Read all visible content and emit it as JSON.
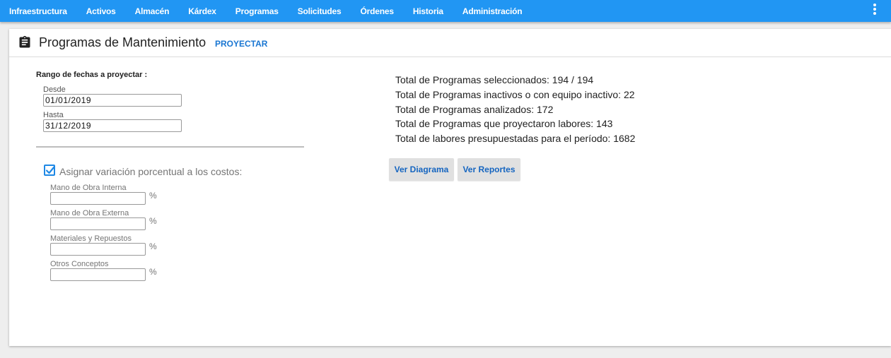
{
  "nav": {
    "items": [
      "Infraestructura",
      "Activos",
      "Almacén",
      "Kárdex",
      "Programas",
      "Solicitudes",
      "Órdenes",
      "Historia",
      "Administración"
    ]
  },
  "header": {
    "title": "Programas de Mantenimiento",
    "action_label": "PROYECTAR"
  },
  "range": {
    "title": "Rango de fechas a proyectar :",
    "from_label": "Desde",
    "from_value": "01/01/2019",
    "to_label": "Hasta",
    "to_value": "31/12/2019"
  },
  "costs": {
    "checkbox_label": "Asignar variación porcentual a los costos:",
    "checked": true,
    "fields": [
      {
        "label": "Mano de Obra Interna",
        "value": "",
        "unit": "%"
      },
      {
        "label": "Mano de Obra Externa",
        "value": "",
        "unit": "%"
      },
      {
        "label": "Materiales y Repuestos",
        "value": "",
        "unit": "%"
      },
      {
        "label": "Otros Conceptos",
        "value": "",
        "unit": "%"
      }
    ]
  },
  "stats": [
    "Total de Programas seleccionados: 194 / 194",
    "Total de Programas inactivos o con equipo inactivo: 22",
    "Total de Programas analizados: 172",
    "Total de Programas que proyectaron labores: 143",
    "Total de labores presupuestadas para el período: 1682"
  ],
  "buttons": {
    "diagram_label": "Ver Diagrama",
    "reports_label": "Ver Reportes"
  },
  "colors": {
    "topbar": "#2196f3",
    "accent": "#1976d2",
    "button_bg": "#e0e0e0"
  },
  "icons": {
    "header": "clipboard-icon",
    "menu": "more-vert-icon",
    "checkbox": "check-icon"
  }
}
